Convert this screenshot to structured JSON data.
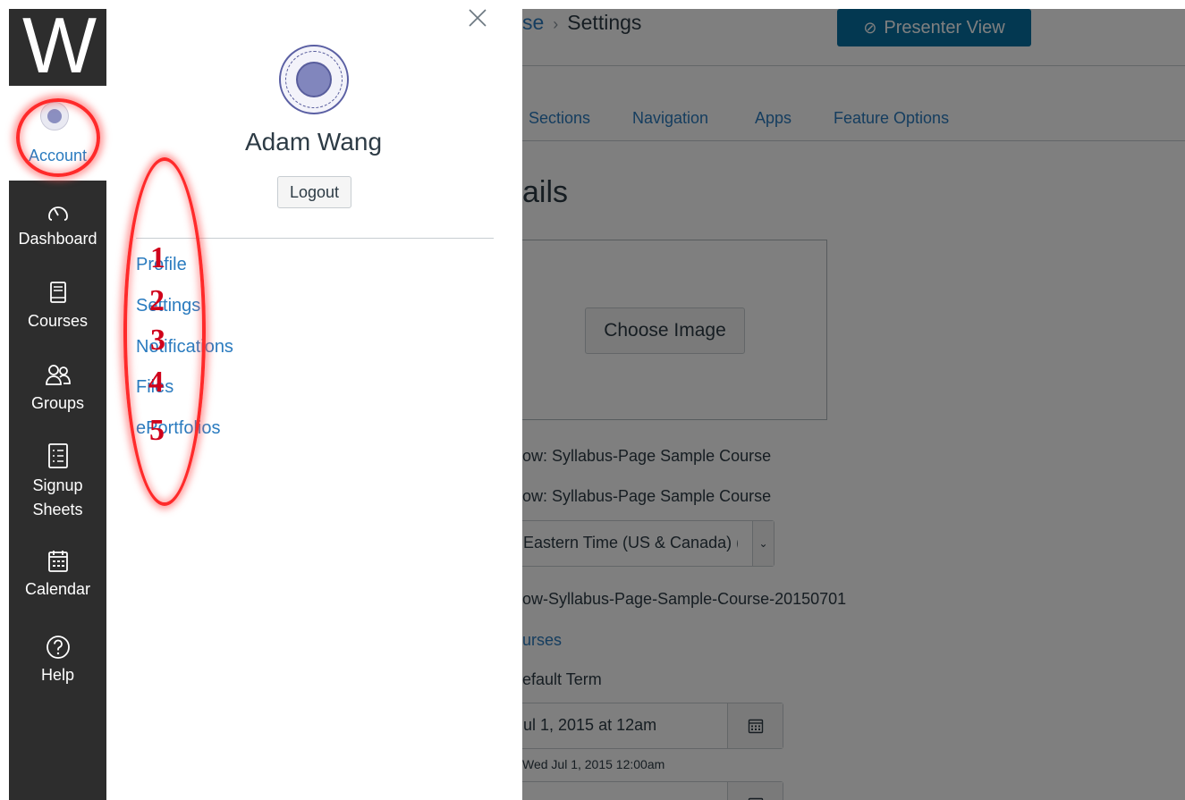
{
  "global_nav": {
    "logo_letter": "W",
    "account_label": "Account",
    "items": [
      {
        "label": "Dashboard",
        "icon": "dashboard-gauge-icon"
      },
      {
        "label": "Courses",
        "icon": "courses-book-icon"
      },
      {
        "label": "Groups",
        "icon": "groups-people-icon"
      },
      {
        "label_line1": "Signup",
        "label_line2": "Sheets",
        "icon": "signup-sheets-list-icon"
      },
      {
        "label": "Calendar",
        "icon": "calendar-icon"
      },
      {
        "label": "Help",
        "icon": "help-question-icon"
      }
    ]
  },
  "account_tray": {
    "user_name": "Adam Wang",
    "logout_label": "Logout",
    "links": [
      "Profile",
      "Settings",
      "Notifications",
      "Files",
      "ePortfolios"
    ],
    "annotation_numbers": [
      "1",
      "2",
      "3",
      "4",
      "5"
    ]
  },
  "course_page": {
    "breadcrumb_partial": "se",
    "breadcrumb_current": "Settings",
    "presenter_view_label": "Presenter View",
    "tabs": [
      "Sections",
      "Navigation",
      "Apps",
      "Feature Options"
    ],
    "heading_partial": "ails",
    "choose_image_label": "Choose Image",
    "name_value": "ow: Syllabus-Page Sample Course",
    "course_code_value": "ow: Syllabus-Page Sample Course",
    "time_zone_value": "Eastern Time (US & Canada) (-",
    "sis_id_value": "ow-Syllabus-Page-Sample-Course-20150701",
    "subaccount_link": "urses",
    "term_value": "efault Term",
    "start_date_value": "ul 1, 2015 at 12am",
    "start_date_hint": "Wed Jul 1, 2015 12:00am"
  },
  "colors": {
    "nav_bg": "#2d2d2d",
    "link_blue": "#2a7bbf",
    "presenter_button_bg": "#0770a3",
    "annotation_red": "#ff2a2a",
    "number_red": "#d0021b"
  }
}
